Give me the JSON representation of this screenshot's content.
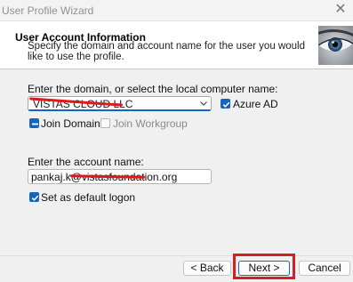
{
  "window": {
    "title": "User Profile Wizard"
  },
  "header": {
    "title": "User Account  Information",
    "description": "Specify the domain and account name for the user you would like to use the profile."
  },
  "form": {
    "domain_label": "Enter the domain, or select the local computer name:",
    "domain_value": "VISTAS CLOUD LLC",
    "azure_ad_label": "Azure AD",
    "azure_ad_checked": true,
    "join_domain_label": "Join Domain",
    "join_domain_checked": true,
    "join_workgroup_label": "Join Workgroup",
    "join_workgroup_checked": false,
    "account_label": "Enter the account name:",
    "account_value": "pankaj.k@vistasfoundation.org",
    "default_logon_label": "Set as default logon",
    "default_logon_checked": true
  },
  "footer": {
    "back_label": "< Back",
    "next_label": "Next >",
    "cancel_label": "Cancel"
  },
  "colors": {
    "accent": "#1565c0",
    "highlight": "#d81f1f",
    "redaction": "#e01818"
  },
  "icons": [
    "close-icon",
    "chevron-down-icon",
    "checkmark-icon",
    "eye-image"
  ]
}
